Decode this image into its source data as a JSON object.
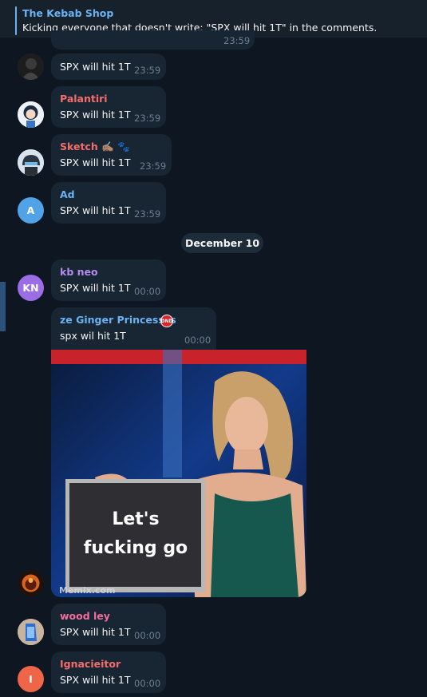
{
  "pinned": {
    "title": "The Kebab Shop",
    "text": "Kicking everyone that doesn't write: \"SPX will hit 1T\" in the comments."
  },
  "partial_message": {
    "time": "23:59"
  },
  "date_separator": "December 10",
  "messages": [
    {
      "sender": "",
      "text": "SPX will hit 1T",
      "time": "23:59",
      "avatar": "dark-figure"
    },
    {
      "sender": "Palantiri",
      "sender_color": "#f36d6d",
      "text": "SPX will hit 1T",
      "time": "23:59",
      "avatar": "anime-girl"
    },
    {
      "sender": "Sketch ✍🏽 🐾",
      "sender_color": "#f36d6d",
      "text": "SPX will hit 1T",
      "time": "23:59",
      "avatar": "helmet-character"
    },
    {
      "sender": "Ad",
      "sender_color": "#6ab3f3",
      "text": "SPX will hit 1T",
      "time": "23:59",
      "avatar_initials": "A",
      "avatar_color": "#4fa3e6"
    },
    {
      "sender": "kb neo",
      "sender_color": "#b38ced",
      "text": "SPX will hit 1T",
      "time": "00:00",
      "avatar_initials": "KN",
      "avatar_color": "#9b6ee6"
    },
    {
      "sender": "ze Ginger Princessss",
      "sender_badge": "DND",
      "sender_color": "#6ab3f3",
      "text": "spx wil hit 1T",
      "time": "00:00",
      "avatar": "fire-figure"
    },
    {
      "sender": "wood ley",
      "sender_color": "#f36d9c",
      "text": "SPX will hit 1T",
      "time": "00:00",
      "avatar": "blue-shoe"
    },
    {
      "sender": "Ignacieitor",
      "sender_color": "#f36d6d",
      "text": "SPX will hit 1T",
      "time": "00:00",
      "avatar_initials": "I",
      "avatar_color": "#ef6548"
    }
  ],
  "gif": {
    "sign_line1": "Let's",
    "sign_line2": "fucking go",
    "watermark": "Memix.com"
  }
}
